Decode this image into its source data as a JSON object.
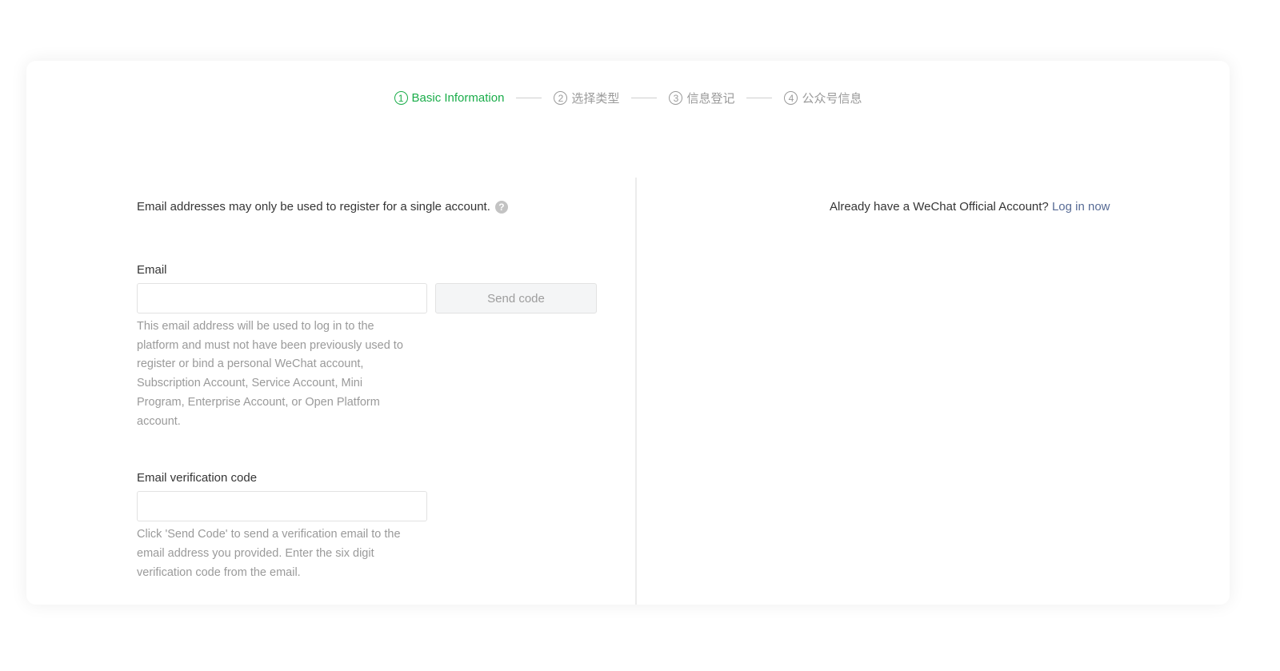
{
  "steps": [
    {
      "num": "1",
      "label": "Basic Information",
      "active": true
    },
    {
      "num": "2",
      "label": "选择类型",
      "active": false
    },
    {
      "num": "3",
      "label": "信息登记",
      "active": false
    },
    {
      "num": "4",
      "label": "公众号信息",
      "active": false
    }
  ],
  "notice": {
    "text": "Email addresses may only be used to register for a single account.",
    "help_icon": "?"
  },
  "email": {
    "label": "Email",
    "value": "",
    "placeholder": "",
    "send_button": "Send code",
    "hint": "This email address will be used to log in to the platform and must not have been previously used to register or bind a personal WeChat account, Subscription Account, Service Account, Mini Program, Enterprise Account, or Open Platform account."
  },
  "verification": {
    "label": "Email verification code",
    "value": "",
    "placeholder": "",
    "hint": "Click 'Send Code' to send a verification email to the email address you provided. Enter the six digit verification code from the email."
  },
  "login": {
    "prompt": "Already have a WeChat Official Account?",
    "link": "Log in now"
  },
  "colors": {
    "accent": "#1aad4a",
    "link": "#576b95",
    "muted": "#9a9a9a"
  }
}
